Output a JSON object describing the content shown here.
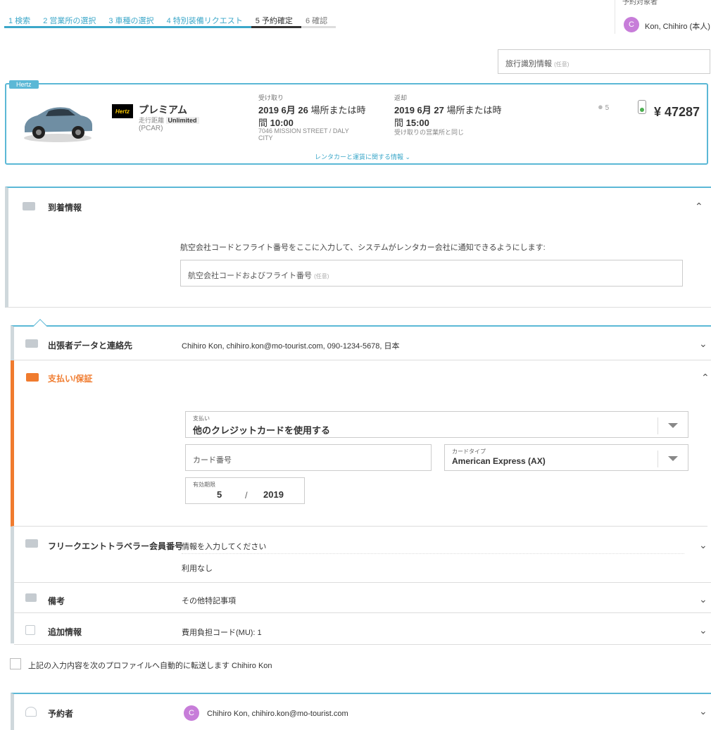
{
  "steps": [
    {
      "label": "1 検索"
    },
    {
      "label": "2 営業所の選択"
    },
    {
      "label": "3 車種の選択"
    },
    {
      "label": "4 特別装備リクエスト"
    },
    {
      "label": "5 予約確定"
    },
    {
      "label": "6 確認"
    }
  ],
  "user": {
    "label": "予約対象者",
    "initial": "C",
    "name": "Kon, Chihiro (本人)"
  },
  "trip_id": {
    "placeholder": "旅行識別情報",
    "optional": "(任意)"
  },
  "car": {
    "vendor_tag": "Hertz",
    "vendor_logo": "Hertz",
    "class": "プレミアム",
    "mileage_label": "走行距離",
    "mileage_value": "Unlimited",
    "code": "(PCAR)",
    "pickup_label": "受け取り",
    "pickup_date": "2019 6月 26",
    "pickup_place": "場所または時",
    "pickup_time_prefix": "間",
    "pickup_time": "10:00",
    "pickup_address": "7046 MISSION STREET / DALY CITY",
    "return_label": "返却",
    "return_date": "2019 6月 27",
    "return_place": "場所または時",
    "return_time_prefix": "間",
    "return_time": "15:00",
    "return_note": "受け取りの営業所と同じ",
    "passengers": "5",
    "price": "¥ 47287",
    "details_link": "レンタカーと運賃に関する情報"
  },
  "arrival": {
    "title": "到着情報",
    "instruction": "航空会社コードとフライト番号をここに入力して、システムがレンタカー会社に通知できるようにします:",
    "flight_placeholder": "航空会社コードおよびフライト番号",
    "optional": "(任意)"
  },
  "traveler": {
    "title": "出張者データと連絡先",
    "value": "Chihiro Kon, chihiro.kon@mo-tourist.com, 090-1234-5678, 日本"
  },
  "payment": {
    "title": "支払い/保証",
    "method_label": "支払い",
    "method_value": "他のクレジットカードを使用する",
    "card_number_placeholder": "カード番号",
    "card_type_label": "カードタイプ",
    "card_type_value": "American Express (AX)",
    "expiry_label": "有効期限",
    "expiry_month": "5",
    "expiry_sep": "/",
    "expiry_year": "2019"
  },
  "frequent": {
    "title": "フリークエントトラベラー会員番号",
    "prompt": "情報を入力してください",
    "value": "利用なし"
  },
  "remarks": {
    "title": "備考",
    "value": "その他特記事項"
  },
  "additional": {
    "title": "追加情報",
    "value": "費用負担コード(MU): 1"
  },
  "forward": {
    "label": "上記の入力内容を次のプロファイルへ自動的に転送します Chihiro Kon"
  },
  "booker": {
    "title": "予約者",
    "initial": "C",
    "value": "Chihiro Kon, chihiro.kon@mo-tourist.com"
  },
  "colors": {
    "accent": "#5bb8d6",
    "payment_accent": "#f07b2e",
    "avatar": "#c77dd9"
  }
}
